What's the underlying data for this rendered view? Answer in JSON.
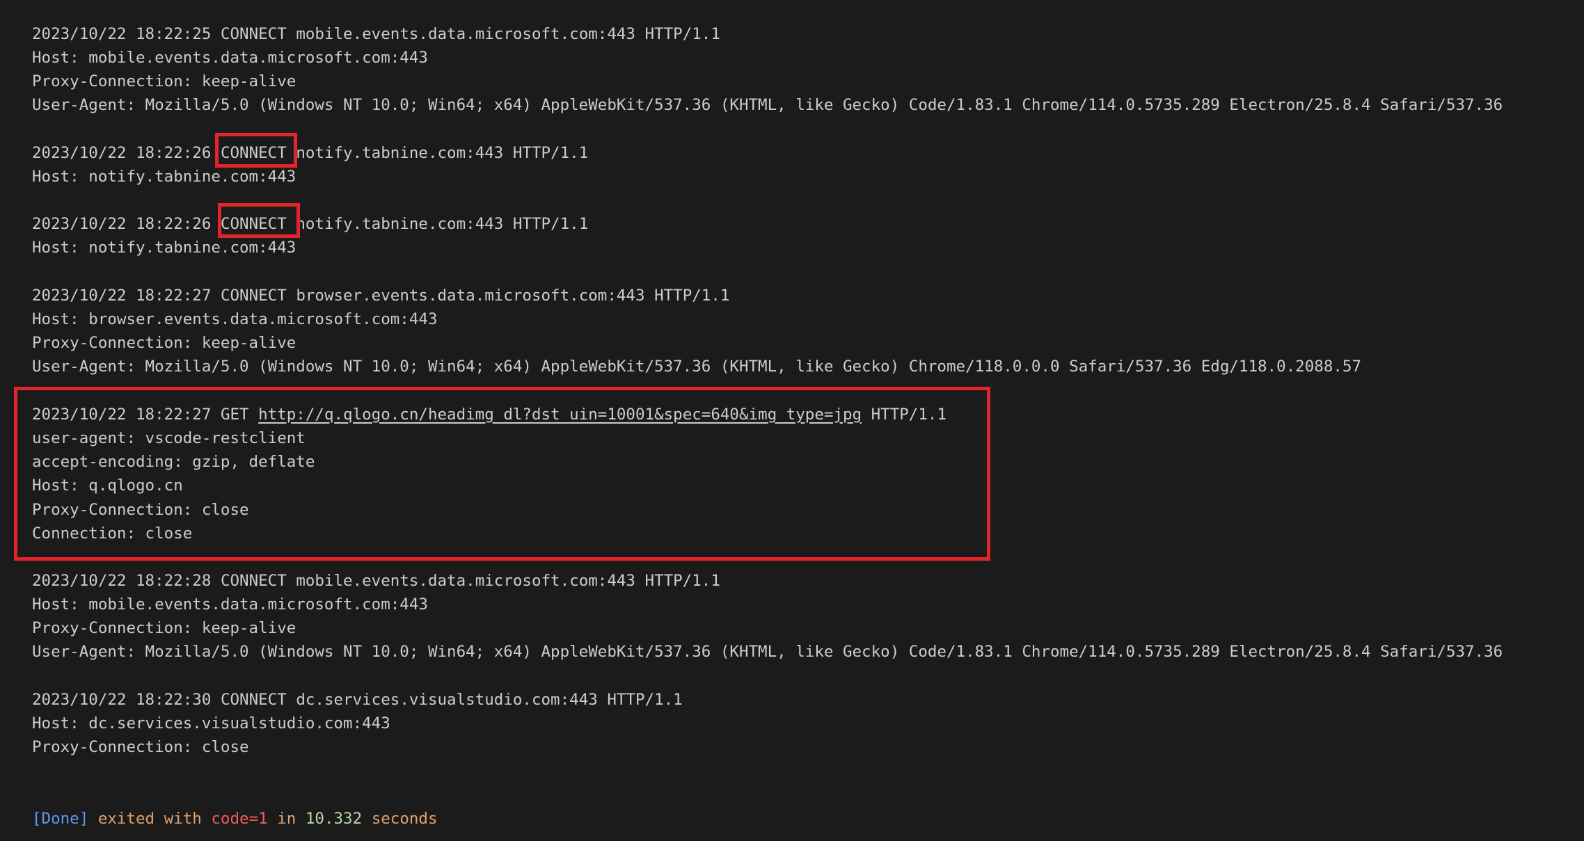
{
  "log": {
    "entry1": {
      "timestamp": "2023/10/22 18:22:25",
      "method": "CONNECT",
      "target": "mobile.events.data.microsoft.com:443",
      "protocol": "HTTP/1.1",
      "headers": [
        "Host: mobile.events.data.microsoft.com:443",
        "Proxy-Connection: keep-alive",
        "User-Agent: Mozilla/5.0 (Windows NT 10.0; Win64; x64) AppleWebKit/537.36 (KHTML, like Gecko) Code/1.83.1 Chrome/114.0.5735.289 Electron/25.8.4 Safari/537.36"
      ]
    },
    "entry2": {
      "timestamp": "2023/10/22 18:22:26",
      "method": "CONNECT",
      "target": "notify.tabnine.com:443",
      "protocol": "HTTP/1.1",
      "headers": [
        "Host: notify.tabnine.com:443"
      ]
    },
    "entry3": {
      "timestamp": "2023/10/22 18:22:26",
      "method": "CONNECT",
      "target": "notify.tabnine.com:443",
      "protocol": "HTTP/1.1",
      "headers": [
        "Host: notify.tabnine.com:443"
      ]
    },
    "entry4": {
      "timestamp": "2023/10/22 18:22:27",
      "method": "CONNECT",
      "target": "browser.events.data.microsoft.com:443",
      "protocol": "HTTP/1.1",
      "headers": [
        "Host: browser.events.data.microsoft.com:443",
        "Proxy-Connection: keep-alive",
        "User-Agent: Mozilla/5.0 (Windows NT 10.0; Win64; x64) AppleWebKit/537.36 (KHTML, like Gecko) Chrome/118.0.0.0 Safari/537.36 Edg/118.0.2088.57"
      ]
    },
    "entry5": {
      "timestamp": "2023/10/22 18:22:27",
      "method": "GET",
      "url": "http://q.qlogo.cn/headimg_dl?dst_uin=10001&spec=640&img_type=jpg",
      "protocol": "HTTP/1.1",
      "headers": [
        "user-agent: vscode-restclient",
        "accept-encoding: gzip, deflate",
        "Host: q.qlogo.cn",
        "Proxy-Connection: close",
        "Connection: close"
      ]
    },
    "entry6": {
      "timestamp": "2023/10/22 18:22:28",
      "method": "CONNECT",
      "target": "mobile.events.data.microsoft.com:443",
      "protocol": "HTTP/1.1",
      "headers": [
        "Host: mobile.events.data.microsoft.com:443",
        "Proxy-Connection: keep-alive",
        "User-Agent: Mozilla/5.0 (Windows NT 10.0; Win64; x64) AppleWebKit/537.36 (KHTML, like Gecko) Code/1.83.1 Chrome/114.0.5735.289 Electron/25.8.4 Safari/537.36"
      ]
    },
    "entry7": {
      "timestamp": "2023/10/22 18:22:30",
      "method": "CONNECT",
      "target": "dc.services.visualstudio.com:443",
      "protocol": "HTTP/1.1",
      "headers": [
        "Host: dc.services.visualstudio.com:443",
        "Proxy-Connection: close"
      ]
    }
  },
  "status": {
    "done_tag": "[Done]",
    "exited_with": "exited with",
    "code": "code=1",
    "in_word": "in",
    "duration": "10.332",
    "seconds": "seconds"
  },
  "colors": {
    "background": "#1b1b1b",
    "text": "#cccccc",
    "highlight_border": "#e3242b",
    "done_tag": "#5a9bea",
    "done_red": "#ef5c5c",
    "done_orange": "#e2a06a",
    "duration": "#b8d7a3"
  }
}
